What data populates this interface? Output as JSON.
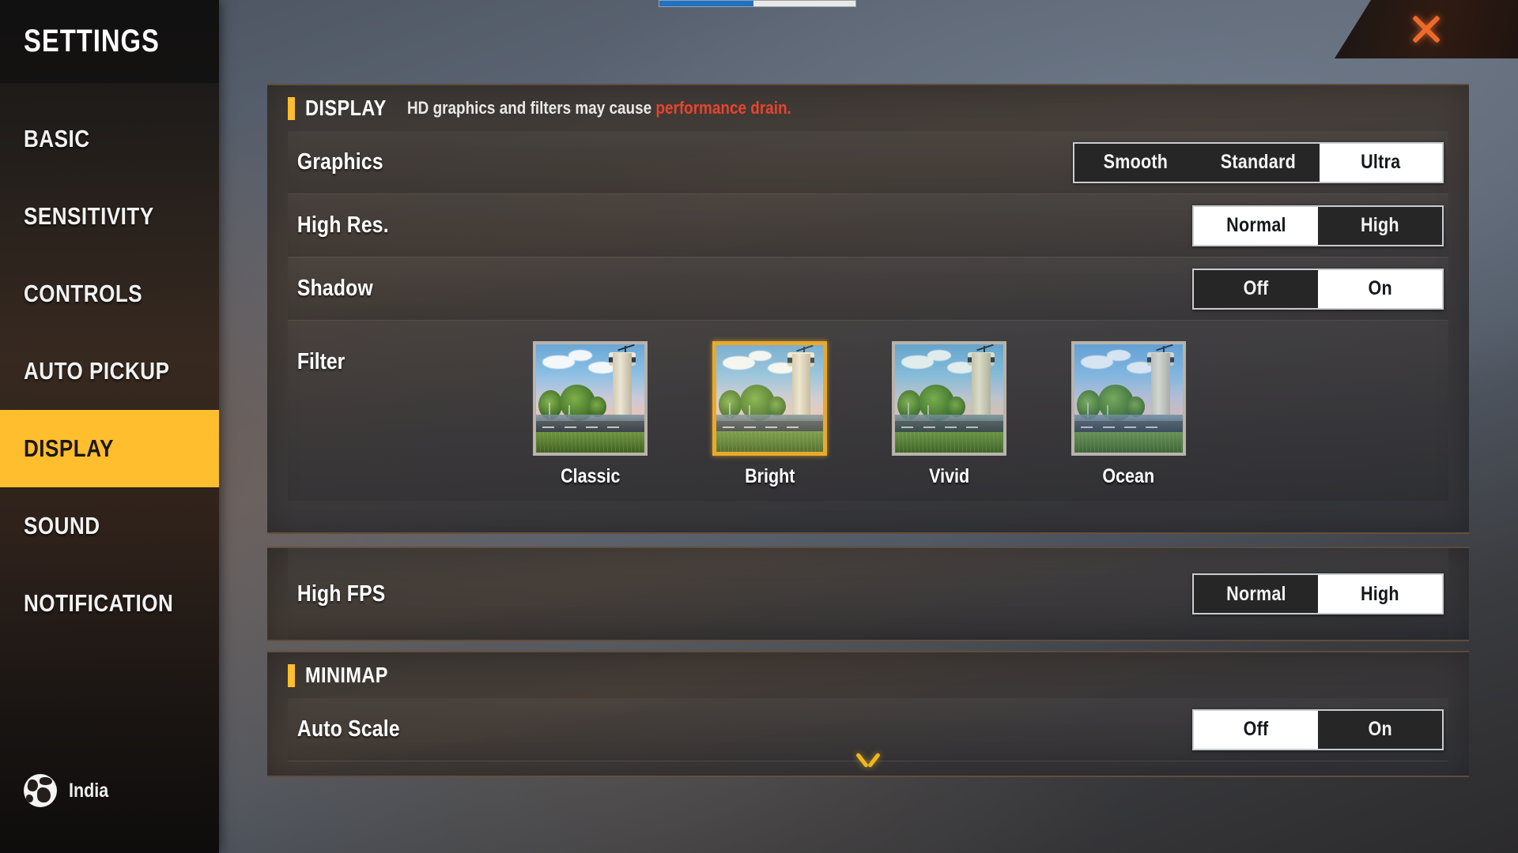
{
  "topbar": {
    "progress_percent": 48
  },
  "close": {
    "icon": "close-x-icon",
    "color": "#ef6a2a"
  },
  "sidebar": {
    "title": "SETTINGS",
    "active_item": "DISPLAY",
    "items": [
      {
        "label": "BASIC"
      },
      {
        "label": "SENSITIVITY"
      },
      {
        "label": "CONTROLS"
      },
      {
        "label": "AUTO PICKUP"
      },
      {
        "label": "DISPLAY"
      },
      {
        "label": "SOUND"
      },
      {
        "label": "NOTIFICATION"
      }
    ],
    "footer": {
      "icon": "globe-icon",
      "label": "India"
    },
    "highlight_color": "#FFBE2E"
  },
  "display_section": {
    "title": "DISPLAY",
    "subtitle_normal": "HD graphics and filters may cause ",
    "subtitle_warning": "performance drain.",
    "warning_color": "#e8442e",
    "accent_color": "#FFBE2E",
    "rows": [
      {
        "label": "Graphics",
        "options": [
          "Smooth",
          "Standard",
          "Ultra"
        ],
        "selected": "Ultra"
      },
      {
        "label": "High Res.",
        "options": [
          "Normal",
          "High"
        ],
        "selected": "Normal"
      },
      {
        "label": "Shadow",
        "options": [
          "Off",
          "On"
        ],
        "selected": "On"
      }
    ],
    "filter": {
      "label": "Filter",
      "selected": "Bright",
      "options": [
        {
          "name": "Classic"
        },
        {
          "name": "Bright"
        },
        {
          "name": "Vivid"
        },
        {
          "name": "Ocean"
        }
      ]
    }
  },
  "fps_section": {
    "rows": [
      {
        "label": "High FPS",
        "options": [
          "Normal",
          "High"
        ],
        "selected": "High"
      }
    ]
  },
  "minimap_section": {
    "title": "MINIMAP",
    "accent_color": "#FFBE2E",
    "rows": [
      {
        "label": "Auto Scale",
        "options": [
          "Off",
          "On"
        ],
        "selected": "Off"
      }
    ]
  },
  "scroll_indicator": {
    "icon": "chevron-down-icon",
    "color": "#f0b81f"
  }
}
